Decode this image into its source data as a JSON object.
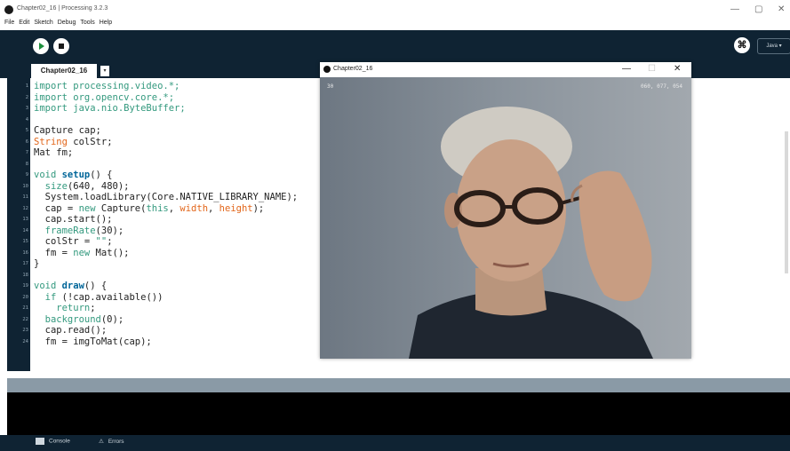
{
  "window": {
    "title": "Chapter02_16 | Processing 3.2.3",
    "minimize": "—",
    "restore": "▢",
    "close": "✕"
  },
  "menu": [
    "File",
    "Edit",
    "Sketch",
    "Debug",
    "Tools",
    "Help"
  ],
  "toolbar": {
    "mode": "Java ▾",
    "debug_glyph": "⌘"
  },
  "tabs": {
    "active": "Chapter02_16",
    "menu_glyph": "▾"
  },
  "code": [
    {
      "n": "1",
      "segs": [
        {
          "t": "import processing.video.*;",
          "c": "kw-green"
        }
      ]
    },
    {
      "n": "2",
      "segs": [
        {
          "t": "import org.opencv.core.*;",
          "c": "kw-green"
        }
      ]
    },
    {
      "n": "3",
      "segs": [
        {
          "t": "import java.nio.ByteBuffer;",
          "c": "kw-green"
        }
      ]
    },
    {
      "n": "4",
      "segs": []
    },
    {
      "n": "5",
      "segs": [
        {
          "t": "Capture cap;",
          "c": ""
        }
      ]
    },
    {
      "n": "6",
      "segs": [
        {
          "t": "String",
          "c": "kw-orange"
        },
        {
          "t": " colStr;",
          "c": ""
        }
      ]
    },
    {
      "n": "7",
      "segs": [
        {
          "t": "Mat fm;",
          "c": ""
        }
      ]
    },
    {
      "n": "8",
      "segs": []
    },
    {
      "n": "9",
      "segs": [
        {
          "t": "void ",
          "c": "kw-green"
        },
        {
          "t": "setup",
          "c": "kw-bold"
        },
        {
          "t": "() {",
          "c": ""
        }
      ]
    },
    {
      "n": "10",
      "segs": [
        {
          "t": "  size",
          "c": "kw-green"
        },
        {
          "t": "(640, 480);",
          "c": ""
        }
      ]
    },
    {
      "n": "11",
      "segs": [
        {
          "t": "  System.loadLibrary(Core.NATIVE_LIBRARY_NAME);",
          "c": ""
        }
      ]
    },
    {
      "n": "12",
      "segs": [
        {
          "t": "  cap = ",
          "c": ""
        },
        {
          "t": "new",
          "c": "kw-green"
        },
        {
          "t": " Capture(",
          "c": ""
        },
        {
          "t": "this",
          "c": "kw-green"
        },
        {
          "t": ", ",
          "c": ""
        },
        {
          "t": "width",
          "c": "kw-orange"
        },
        {
          "t": ", ",
          "c": ""
        },
        {
          "t": "height",
          "c": "kw-orange"
        },
        {
          "t": ");",
          "c": ""
        }
      ]
    },
    {
      "n": "13",
      "segs": [
        {
          "t": "  cap.start();",
          "c": ""
        }
      ]
    },
    {
      "n": "14",
      "segs": [
        {
          "t": "  frameRate",
          "c": "kw-green"
        },
        {
          "t": "(30);",
          "c": ""
        }
      ]
    },
    {
      "n": "15",
      "segs": [
        {
          "t": "  colStr = ",
          "c": ""
        },
        {
          "t": "\"\"",
          "c": "kw-green"
        },
        {
          "t": ";",
          "c": ""
        }
      ]
    },
    {
      "n": "16",
      "segs": [
        {
          "t": "  fm = ",
          "c": ""
        },
        {
          "t": "new",
          "c": "kw-green"
        },
        {
          "t": " Mat();",
          "c": ""
        }
      ]
    },
    {
      "n": "17",
      "segs": [
        {
          "t": "}",
          "c": ""
        }
      ]
    },
    {
      "n": "18",
      "segs": []
    },
    {
      "n": "19",
      "segs": [
        {
          "t": "void ",
          "c": "kw-green"
        },
        {
          "t": "draw",
          "c": "kw-bold"
        },
        {
          "t": "() {",
          "c": ""
        }
      ]
    },
    {
      "n": "20",
      "segs": [
        {
          "t": "  if",
          "c": "kw-green"
        },
        {
          "t": " (!cap.available())",
          "c": ""
        }
      ]
    },
    {
      "n": "21",
      "segs": [
        {
          "t": "    return",
          "c": "kw-green"
        },
        {
          "t": ";",
          "c": ""
        }
      ]
    },
    {
      "n": "22",
      "segs": [
        {
          "t": "  background",
          "c": "kw-green"
        },
        {
          "t": "(0);",
          "c": ""
        }
      ]
    },
    {
      "n": "23",
      "segs": [
        {
          "t": "  cap.read();",
          "c": ""
        }
      ]
    },
    {
      "n": "24",
      "segs": [
        {
          "t": "  fm = imgToMat(cap);",
          "c": ""
        }
      ]
    }
  ],
  "sketch": {
    "title": "Chapter02_16",
    "fps": "30",
    "rgb": "060, 077, 054",
    "minimize": "—",
    "restore": "☐",
    "close": "✕"
  },
  "console": {
    "console_label": "Console",
    "errors_label": "Errors"
  }
}
